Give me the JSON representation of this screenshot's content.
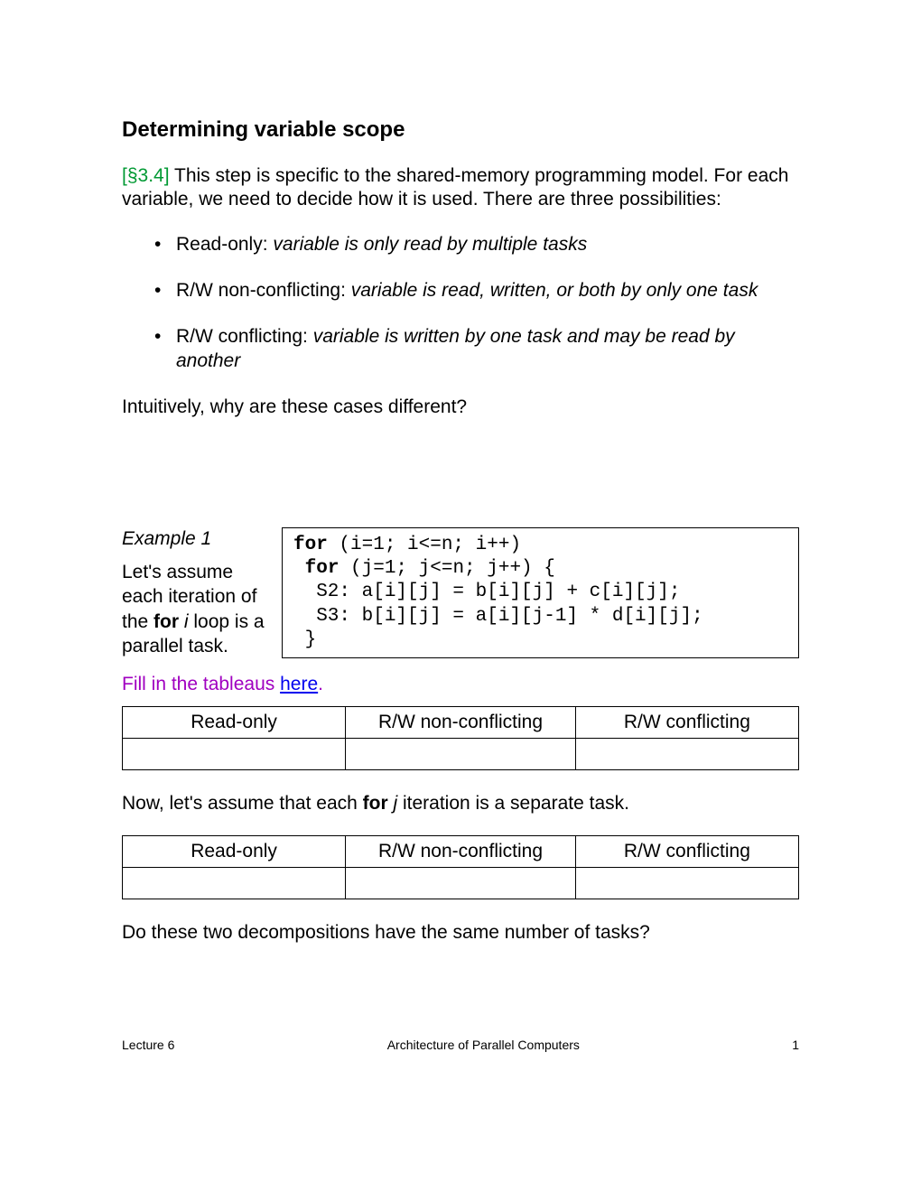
{
  "heading": "Determining variable scope",
  "section_ref": "[§3.4]",
  "intro_body": "   This step is specific to the shared-memory programming model.  For each variable, we need to decide how it is used.  There are three possibilities:",
  "bullets": [
    {
      "lead": "Read-only: ",
      "desc": "variable is only read by multiple tasks"
    },
    {
      "lead": "R/W non-conflicting: ",
      "desc": "variable is read, written, or both by only one task"
    },
    {
      "lead": "R/W conflicting: ",
      "desc": "variable is written by one task and may be read by another"
    }
  ],
  "question1": "Intuitively, why are these cases different?",
  "example_label": "Example 1",
  "example_left": {
    "p1a": "Let's assume each iteration of the ",
    "p1b": "for",
    "p1c": " i",
    "p1d": " loop is a parallel task."
  },
  "code_lines": "for (i=1; i<=n; i++)\n for (j=1; j<=n; j++) {\n  S2: a[i][j] = b[i][j] + c[i][j];\n  S3: b[i][j] = a[i][j-1] * d[i][j];\n }",
  "fillin": {
    "prefix": "Fill in the tableaus ",
    "link": "here",
    "suffix": "."
  },
  "table": {
    "h1": "Read-only",
    "h2": "R/W non-conflicting",
    "h3": "R/W conflicting"
  },
  "between": {
    "a": "Now, let's assume that each ",
    "b": "for",
    "c": " j",
    "d": " iteration is a separate task."
  },
  "question2": "Do these two decompositions have the same number of tasks?",
  "footer": {
    "left": "Lecture 6",
    "center": "Architecture of Parallel Computers",
    "right": "1"
  }
}
